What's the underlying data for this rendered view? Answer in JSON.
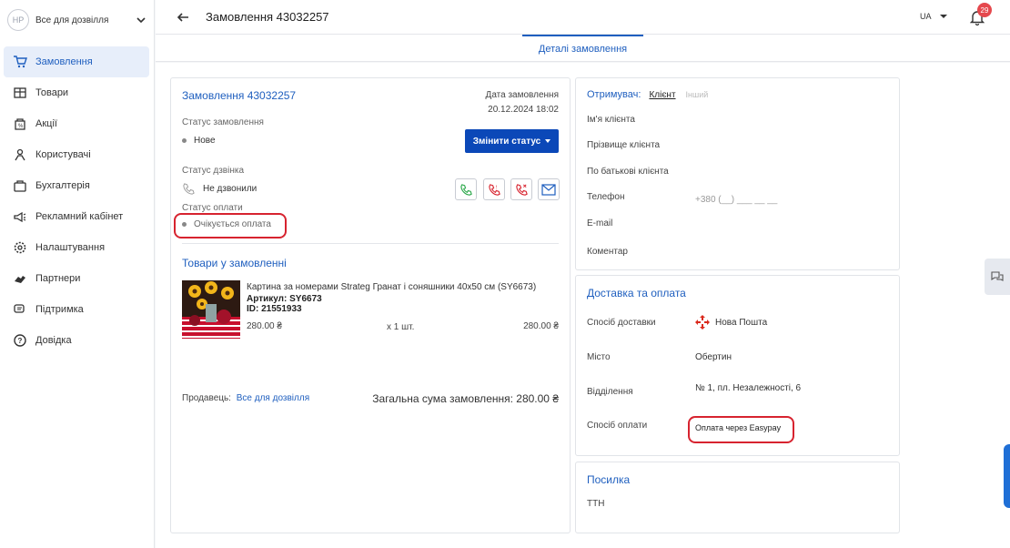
{
  "sidebar": {
    "shop": {
      "avatar": "НР",
      "name": "Все для дозвілля"
    },
    "items": [
      {
        "label": "Замовлення",
        "icon": "cart-icon",
        "active": true
      },
      {
        "label": "Товари",
        "icon": "products-icon"
      },
      {
        "label": "Акції",
        "icon": "promo-icon"
      },
      {
        "label": "Користувачі",
        "icon": "users-icon"
      },
      {
        "label": "Бухгалтерія",
        "icon": "accounting-icon"
      },
      {
        "label": "Рекламний кабінет",
        "icon": "megaphone-icon"
      },
      {
        "label": "Налаштування",
        "icon": "gear-icon"
      },
      {
        "label": "Партнери",
        "icon": "handshake-icon"
      },
      {
        "label": "Підтримка",
        "icon": "chat-icon"
      },
      {
        "label": "Довідка",
        "icon": "help-icon"
      }
    ]
  },
  "header": {
    "title": "Замовлення 43032257",
    "lang": "UA",
    "notifications": "29"
  },
  "tabs": [
    {
      "label": "Деталі замовлення"
    }
  ],
  "order": {
    "title": "Замовлення 43032257",
    "date_label": "Дата замовлення",
    "date_value": "20.12.2024 18:02",
    "status_label": "Статус замовлення",
    "status_value": "Нове",
    "change_status": "Змінити статус",
    "call_status_label": "Статус дзвінка",
    "call_status_value": "Не дзвонили",
    "payment_status_label": "Статус оплати",
    "payment_status_value": "Очікується оплата",
    "items_title": "Товари у замовленні",
    "product": {
      "name": "Картина за номерами Strateg Гранат і соняшники 40x50 см (SY6673)",
      "sku": "Артикул: SY6673",
      "id": "ID: 21551933",
      "price": "280.00 ₴",
      "qty": "x 1 шт.",
      "total": "280.00 ₴"
    },
    "seller_label": "Продавець:",
    "seller_name": "Все для дозвілля",
    "order_total": "Загальна сума замовлення: 280.00 ₴"
  },
  "recipient": {
    "title": "Отримувач:",
    "tab_client": "Клієнт",
    "tab_other": "Інший",
    "first_name": "Ім'я клієнта",
    "last_name": "Прізвище клієнта",
    "middle_name": "По батькові клієнта",
    "phone_label": "Телефон",
    "phone_placeholder": "+380 (__) ___ __ __",
    "email": "E-mail",
    "comment": "Коментар"
  },
  "delivery": {
    "title": "Доставка та оплата",
    "method_label": "Спосіб доставки",
    "method_value": "Нова Пошта",
    "city_label": "Місто",
    "city_value": "Обертин",
    "branch_label": "Відділення",
    "branch_value": "№ 1, пл. Незалежності, 6",
    "payment_label": "Спосіб оплати",
    "payment_value": "Оплата через Easypay"
  },
  "parcel": {
    "title": "Посилка",
    "ttn": "ТТН"
  },
  "colors": {
    "accent": "#1f5fbf",
    "button": "#0b48b8",
    "highlight": "#d7232f",
    "badge": "#e5484d"
  }
}
